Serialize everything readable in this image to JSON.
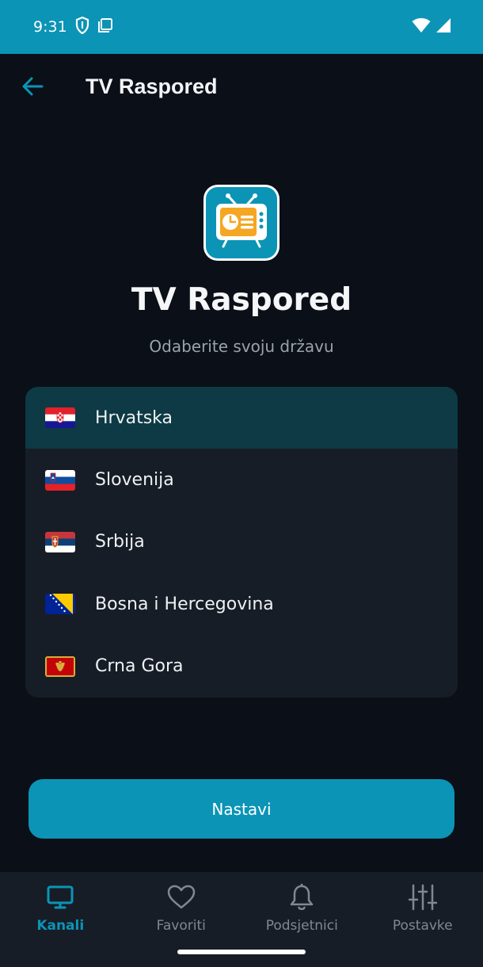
{
  "status_bar": {
    "time": "9:31",
    "icons": [
      "shield-icon",
      "clipboard-icon",
      "wifi-icon",
      "cellular-signal-icon"
    ]
  },
  "app_bar": {
    "title": "TV Raspored",
    "back_icon": "back-arrow-icon"
  },
  "hero": {
    "app_name": "TV Raspored",
    "subtitle": "Odaberite svoju državu"
  },
  "countries": [
    {
      "name": "Hrvatska",
      "flag": "flag-croatia",
      "selected": true
    },
    {
      "name": "Slovenija",
      "flag": "flag-slovenia",
      "selected": false
    },
    {
      "name": "Srbija",
      "flag": "flag-serbia",
      "selected": false
    },
    {
      "name": "Bosna i Hercegovina",
      "flag": "flag-bosnia",
      "selected": false
    },
    {
      "name": "Crna Gora",
      "flag": "flag-montenegro",
      "selected": false
    }
  ],
  "continue_button": {
    "label": "Nastavi"
  },
  "bottom_nav": {
    "items": [
      {
        "label": "Kanali",
        "icon": "tv-icon",
        "active": true
      },
      {
        "label": "Favoriti",
        "icon": "heart-icon",
        "active": false
      },
      {
        "label": "Podsjetnici",
        "icon": "bell-icon",
        "active": false
      },
      {
        "label": "Postavke",
        "icon": "sliders-icon",
        "active": false
      }
    ]
  },
  "colors": {
    "accent": "#0b94b6",
    "background": "#0b0f17",
    "surface": "#171d26",
    "selected_row": "#0d3a44",
    "logo_orange": "#f5a623"
  }
}
